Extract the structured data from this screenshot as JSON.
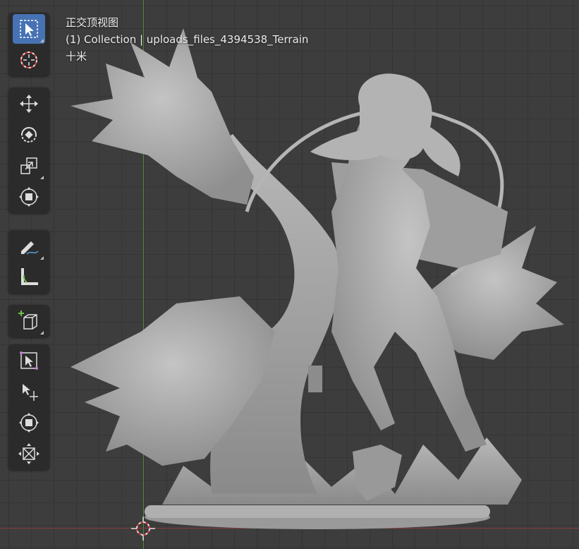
{
  "viewport": {
    "view_name": "正交顶视图",
    "collection_line": "(1) Collection | uploads_files_4394538_Terrain",
    "scale_label": "十米"
  },
  "toolbar": {
    "tools": [
      {
        "name": "select-box",
        "icon": "select-box-icon",
        "active": true
      },
      {
        "name": "cursor",
        "icon": "cursor-icon",
        "active": false
      },
      {
        "name": "move",
        "icon": "move-icon",
        "active": false
      },
      {
        "name": "rotate",
        "icon": "rotate-icon",
        "active": false
      },
      {
        "name": "scale",
        "icon": "scale-icon",
        "active": false
      },
      {
        "name": "transform",
        "icon": "transform-icon",
        "active": false
      },
      {
        "name": "annotate",
        "icon": "annotate-icon",
        "active": false
      },
      {
        "name": "measure",
        "icon": "measure-icon",
        "active": false
      },
      {
        "name": "add-cube",
        "icon": "add-cube-icon",
        "active": false
      },
      {
        "name": "shear",
        "icon": "shear-icon",
        "active": false
      },
      {
        "name": "push-pull",
        "icon": "push-pull-icon",
        "active": false
      },
      {
        "name": "to-sphere",
        "icon": "to-sphere-icon",
        "active": false
      },
      {
        "name": "shrink-fatten",
        "icon": "shrink-fatten-icon",
        "active": false
      }
    ]
  },
  "colors": {
    "grid_bg": "#3d3d3d",
    "grid_line": "#353535",
    "y_axis": "#4f8d3b",
    "x_axis": "#8c3a3a",
    "active_tool": "#4772b3",
    "model": "#a7a7a7"
  }
}
